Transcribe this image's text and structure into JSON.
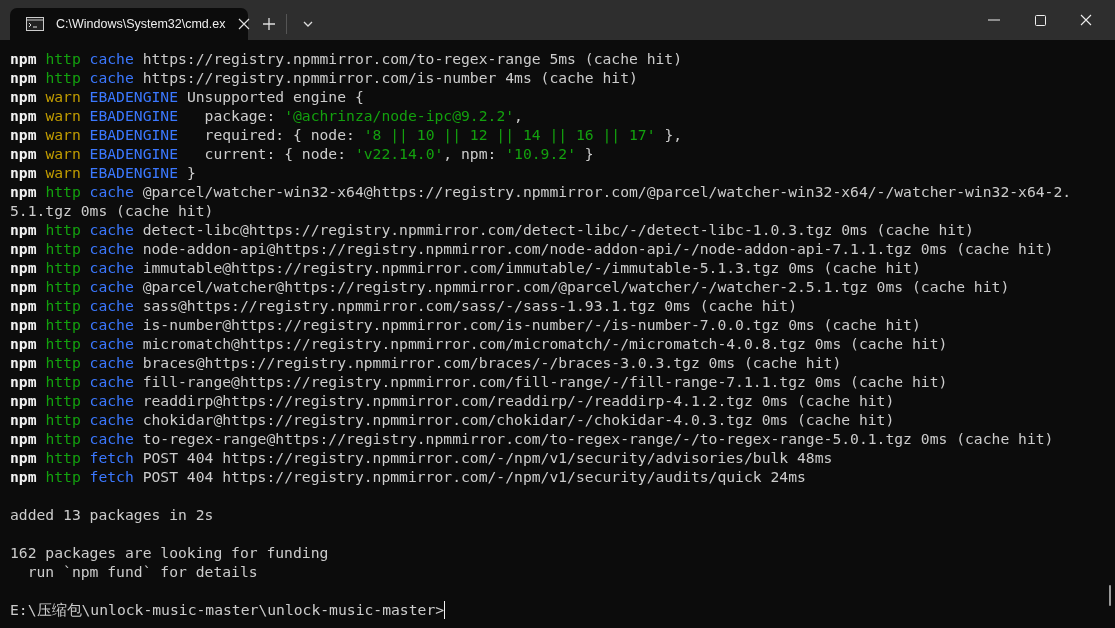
{
  "window": {
    "tabs": [
      {
        "title": "C:\\Windows\\System32\\cmd.ex",
        "selected": true
      }
    ]
  },
  "terminal": {
    "blocks": [
      {
        "lines": [
          {
            "segments": [
              {
                "kind": "prefix",
                "text": "npm"
              },
              {
                "kind": "http",
                "text": "http"
              },
              {
                "kind": "tag",
                "text": "cache"
              },
              {
                "kind": "plain",
                "text": "https://registry.npmmirror.com/to-regex-range 5ms (cache hit)"
              }
            ]
          },
          {
            "segments": [
              {
                "kind": "prefix",
                "text": "npm"
              },
              {
                "kind": "http",
                "text": "http"
              },
              {
                "kind": "tag",
                "text": "cache"
              },
              {
                "kind": "plain",
                "text": "https://registry.npmmirror.com/is-number 4ms (cache hit)"
              }
            ]
          },
          {
            "segments": [
              {
                "kind": "prefix",
                "text": "npm"
              },
              {
                "kind": "warn",
                "text": "warn"
              },
              {
                "kind": "tag",
                "text": "EBADENGINE"
              },
              {
                "kind": "plain",
                "text": "Unsupported engine {"
              }
            ]
          },
          {
            "segments": [
              {
                "kind": "prefix",
                "text": "npm"
              },
              {
                "kind": "warn",
                "text": "warn"
              },
              {
                "kind": "tag",
                "text": "EBADENGINE"
              },
              {
                "kind": "plain",
                "text": "  package: "
              },
              {
                "kind": "string",
                "text": "'@achrinza/node-ipc@9.2.2'"
              },
              {
                "kind": "plain",
                "text": ","
              }
            ]
          },
          {
            "segments": [
              {
                "kind": "prefix",
                "text": "npm"
              },
              {
                "kind": "warn",
                "text": "warn"
              },
              {
                "kind": "tag",
                "text": "EBADENGINE"
              },
              {
                "kind": "plain",
                "text": "  required: { node: "
              },
              {
                "kind": "string",
                "text": "'8 || 10 || 12 || 14 || 16 || 17'"
              },
              {
                "kind": "plain",
                "text": " },"
              }
            ]
          },
          {
            "segments": [
              {
                "kind": "prefix",
                "text": "npm"
              },
              {
                "kind": "warn",
                "text": "warn"
              },
              {
                "kind": "tag",
                "text": "EBADENGINE"
              },
              {
                "kind": "plain",
                "text": "  current: { node: "
              },
              {
                "kind": "string",
                "text": "'v22.14.0'"
              },
              {
                "kind": "plain",
                "text": ", npm: "
              },
              {
                "kind": "string",
                "text": "'10.9.2'"
              },
              {
                "kind": "plain",
                "text": " }"
              }
            ]
          },
          {
            "segments": [
              {
                "kind": "prefix",
                "text": "npm"
              },
              {
                "kind": "warn",
                "text": "warn"
              },
              {
                "kind": "tag",
                "text": "EBADENGINE"
              },
              {
                "kind": "plain",
                "text": "}"
              }
            ]
          },
          {
            "segments": [
              {
                "kind": "prefix",
                "text": "npm"
              },
              {
                "kind": "http",
                "text": "http"
              },
              {
                "kind": "tag",
                "text": "cache"
              },
              {
                "kind": "plain",
                "text": "@parcel/watcher-win32-x64@https://registry.npmmirror.com/@parcel/watcher-win32-x64/-/watcher-win32-x64-2."
              }
            ]
          },
          {
            "segments": [
              {
                "kind": "plain",
                "text": "5.1.tgz 0ms (cache hit)"
              }
            ]
          },
          {
            "segments": [
              {
                "kind": "prefix",
                "text": "npm"
              },
              {
                "kind": "http",
                "text": "http"
              },
              {
                "kind": "tag",
                "text": "cache"
              },
              {
                "kind": "plain",
                "text": "detect-libc@https://registry.npmmirror.com/detect-libc/-/detect-libc-1.0.3.tgz 0ms (cache hit)"
              }
            ]
          },
          {
            "segments": [
              {
                "kind": "prefix",
                "text": "npm"
              },
              {
                "kind": "http",
                "text": "http"
              },
              {
                "kind": "tag",
                "text": "cache"
              },
              {
                "kind": "plain",
                "text": "node-addon-api@https://registry.npmmirror.com/node-addon-api/-/node-addon-api-7.1.1.tgz 0ms (cache hit)"
              }
            ]
          },
          {
            "segments": [
              {
                "kind": "prefix",
                "text": "npm"
              },
              {
                "kind": "http",
                "text": "http"
              },
              {
                "kind": "tag",
                "text": "cache"
              },
              {
                "kind": "plain",
                "text": "immutable@https://registry.npmmirror.com/immutable/-/immutable-5.1.3.tgz 0ms (cache hit)"
              }
            ]
          },
          {
            "segments": [
              {
                "kind": "prefix",
                "text": "npm"
              },
              {
                "kind": "http",
                "text": "http"
              },
              {
                "kind": "tag",
                "text": "cache"
              },
              {
                "kind": "plain",
                "text": "@parcel/watcher@https://registry.npmmirror.com/@parcel/watcher/-/watcher-2.5.1.tgz 0ms (cache hit)"
              }
            ]
          },
          {
            "segments": [
              {
                "kind": "prefix",
                "text": "npm"
              },
              {
                "kind": "http",
                "text": "http"
              },
              {
                "kind": "tag",
                "text": "cache"
              },
              {
                "kind": "plain",
                "text": "sass@https://registry.npmmirror.com/sass/-/sass-1.93.1.tgz 0ms (cache hit)"
              }
            ]
          },
          {
            "segments": [
              {
                "kind": "prefix",
                "text": "npm"
              },
              {
                "kind": "http",
                "text": "http"
              },
              {
                "kind": "tag",
                "text": "cache"
              },
              {
                "kind": "plain",
                "text": "is-number@https://registry.npmmirror.com/is-number/-/is-number-7.0.0.tgz 0ms (cache hit)"
              }
            ]
          },
          {
            "segments": [
              {
                "kind": "prefix",
                "text": "npm"
              },
              {
                "kind": "http",
                "text": "http"
              },
              {
                "kind": "tag",
                "text": "cache"
              },
              {
                "kind": "plain",
                "text": "micromatch@https://registry.npmmirror.com/micromatch/-/micromatch-4.0.8.tgz 0ms (cache hit)"
              }
            ]
          },
          {
            "segments": [
              {
                "kind": "prefix",
                "text": "npm"
              },
              {
                "kind": "http",
                "text": "http"
              },
              {
                "kind": "tag",
                "text": "cache"
              },
              {
                "kind": "plain",
                "text": "braces@https://registry.npmmirror.com/braces/-/braces-3.0.3.tgz 0ms (cache hit)"
              }
            ]
          },
          {
            "segments": [
              {
                "kind": "prefix",
                "text": "npm"
              },
              {
                "kind": "http",
                "text": "http"
              },
              {
                "kind": "tag",
                "text": "cache"
              },
              {
                "kind": "plain",
                "text": "fill-range@https://registry.npmmirror.com/fill-range/-/fill-range-7.1.1.tgz 0ms (cache hit)"
              }
            ]
          },
          {
            "segments": [
              {
                "kind": "prefix",
                "text": "npm"
              },
              {
                "kind": "http",
                "text": "http"
              },
              {
                "kind": "tag",
                "text": "cache"
              },
              {
                "kind": "plain",
                "text": "readdirp@https://registry.npmmirror.com/readdirp/-/readdirp-4.1.2.tgz 0ms (cache hit)"
              }
            ]
          },
          {
            "segments": [
              {
                "kind": "prefix",
                "text": "npm"
              },
              {
                "kind": "http",
                "text": "http"
              },
              {
                "kind": "tag",
                "text": "cache"
              },
              {
                "kind": "plain",
                "text": "chokidar@https://registry.npmmirror.com/chokidar/-/chokidar-4.0.3.tgz 0ms (cache hit)"
              }
            ]
          },
          {
            "segments": [
              {
                "kind": "prefix",
                "text": "npm"
              },
              {
                "kind": "http",
                "text": "http"
              },
              {
                "kind": "tag",
                "text": "cache"
              },
              {
                "kind": "plain",
                "text": "to-regex-range@https://registry.npmmirror.com/to-regex-range/-/to-regex-range-5.0.1.tgz 0ms (cache hit)"
              }
            ]
          },
          {
            "segments": [
              {
                "kind": "prefix",
                "text": "npm"
              },
              {
                "kind": "http",
                "text": "http"
              },
              {
                "kind": "tag",
                "text": "fetch"
              },
              {
                "kind": "plain",
                "text": "POST 404 https://registry.npmmirror.com/-/npm/v1/security/advisories/bulk 48ms"
              }
            ]
          },
          {
            "segments": [
              {
                "kind": "prefix",
                "text": "npm"
              },
              {
                "kind": "http",
                "text": "http"
              },
              {
                "kind": "tag",
                "text": "fetch"
              },
              {
                "kind": "plain",
                "text": "POST 404 https://registry.npmmirror.com/-/npm/v1/security/audits/quick 24ms"
              }
            ]
          }
        ]
      },
      {
        "lines": [
          {
            "segments": [
              {
                "kind": "plain",
                "text": "added 13 packages in 2s"
              }
            ]
          }
        ]
      },
      {
        "lines": [
          {
            "segments": [
              {
                "kind": "plain",
                "text": "162 packages are looking for funding"
              }
            ]
          },
          {
            "segments": [
              {
                "kind": "plain",
                "text": "  run `npm fund` for details"
              }
            ]
          }
        ]
      }
    ],
    "prompt": {
      "text": "E:\\压缩包\\unlock-music-master\\unlock-music-master>",
      "cursor": true
    }
  }
}
